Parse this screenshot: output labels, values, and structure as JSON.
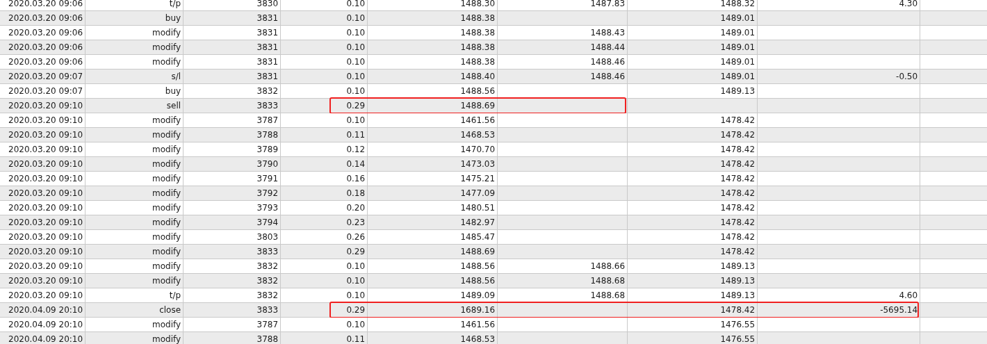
{
  "rows": [
    {
      "column_1": "2020.03.20 09:06",
      "column_2": "t/p",
      "column_3": "3830",
      "column_4": "0.10",
      "column_5": "1488.30",
      "column_6": "1487.83",
      "column_7": "1488.32",
      "column_8": "4.30"
    },
    {
      "column_1": "2020.03.20 09:06",
      "column_2": "buy",
      "column_3": "3831",
      "column_4": "0.10",
      "column_5": "1488.38",
      "column_7": "1489.01"
    },
    {
      "column_1": "2020.03.20 09:06",
      "column_2": "modify",
      "column_3": "3831",
      "column_4": "0.10",
      "column_5": "1488.38",
      "column_6": "1488.43",
      "column_7": "1489.01"
    },
    {
      "column_1": "2020.03.20 09:06",
      "column_2": "modify",
      "column_3": "3831",
      "column_4": "0.10",
      "column_5": "1488.38",
      "column_6": "1488.44",
      "column_7": "1489.01"
    },
    {
      "column_1": "2020.03.20 09:06",
      "column_2": "modify",
      "column_3": "3831",
      "column_4": "0.10",
      "column_5": "1488.38",
      "column_6": "1488.46",
      "column_7": "1489.01"
    },
    {
      "column_1": "2020.03.20 09:07",
      "column_2": "s/l",
      "column_3": "3831",
      "column_4": "0.10",
      "column_5": "1488.40",
      "column_6": "1488.46",
      "column_7": "1489.01",
      "column_8": "-0.50"
    },
    {
      "column_1": "2020.03.20 09:07",
      "column_2": "buy",
      "column_3": "3832",
      "column_4": "0.10",
      "column_5": "1488.56",
      "column_7": "1489.13"
    },
    {
      "column_1": "2020.03.20 09:10",
      "column_2": "sell",
      "column_3": "3833",
      "column_4": "0.29",
      "column_5": "1488.69",
      "boxed": true,
      "box_wide": false
    },
    {
      "column_1": "2020.03.20 09:10",
      "column_2": "modify",
      "column_3": "3787",
      "column_4": "0.10",
      "column_5": "1461.56",
      "column_7": "1478.42"
    },
    {
      "column_1": "2020.03.20 09:10",
      "column_2": "modify",
      "column_3": "3788",
      "column_4": "0.11",
      "column_5": "1468.53",
      "column_7": "1478.42"
    },
    {
      "column_1": "2020.03.20 09:10",
      "column_2": "modify",
      "column_3": "3789",
      "column_4": "0.12",
      "column_5": "1470.70",
      "column_7": "1478.42"
    },
    {
      "column_1": "2020.03.20 09:10",
      "column_2": "modify",
      "column_3": "3790",
      "column_4": "0.14",
      "column_5": "1473.03",
      "column_7": "1478.42"
    },
    {
      "column_1": "2020.03.20 09:10",
      "column_2": "modify",
      "column_3": "3791",
      "column_4": "0.16",
      "column_5": "1475.21",
      "column_7": "1478.42"
    },
    {
      "column_1": "2020.03.20 09:10",
      "column_2": "modify",
      "column_3": "3792",
      "column_4": "0.18",
      "column_5": "1477.09",
      "column_7": "1478.42"
    },
    {
      "column_1": "2020.03.20 09:10",
      "column_2": "modify",
      "column_3": "3793",
      "column_4": "0.20",
      "column_5": "1480.51",
      "column_7": "1478.42"
    },
    {
      "column_1": "2020.03.20 09:10",
      "column_2": "modify",
      "column_3": "3794",
      "column_4": "0.23",
      "column_5": "1482.97",
      "column_7": "1478.42"
    },
    {
      "column_1": "2020.03.20 09:10",
      "column_2": "modify",
      "column_3": "3803",
      "column_4": "0.26",
      "column_5": "1485.47",
      "column_7": "1478.42"
    },
    {
      "column_1": "2020.03.20 09:10",
      "column_2": "modify",
      "column_3": "3833",
      "column_4": "0.29",
      "column_5": "1488.69",
      "column_7": "1478.42"
    },
    {
      "column_1": "2020.03.20 09:10",
      "column_2": "modify",
      "column_3": "3832",
      "column_4": "0.10",
      "column_5": "1488.56",
      "column_6": "1488.66",
      "column_7": "1489.13"
    },
    {
      "column_1": "2020.03.20 09:10",
      "column_2": "modify",
      "column_3": "3832",
      "column_4": "0.10",
      "column_5": "1488.56",
      "column_6": "1488.68",
      "column_7": "1489.13"
    },
    {
      "column_1": "2020.03.20 09:10",
      "column_2": "t/p",
      "column_3": "3832",
      "column_4": "0.10",
      "column_5": "1489.09",
      "column_6": "1488.68",
      "column_7": "1489.13",
      "column_8": "4.60"
    },
    {
      "column_1": "2020.04.09 20:10",
      "column_2": "close",
      "column_3": "3833",
      "column_4": "0.29",
      "column_5": "1689.16",
      "column_7": "1478.42",
      "column_8": "-5695.14",
      "boxed": true,
      "box_wide": true
    },
    {
      "column_1": "2020.04.09 20:10",
      "column_2": "modify",
      "column_3": "3787",
      "column_4": "0.10",
      "column_5": "1461.56",
      "column_7": "1476.55"
    },
    {
      "column_1": "2020.04.09 20:10",
      "column_2": "modify",
      "column_3": "3788",
      "column_4": "0.11",
      "column_5": "1468.53",
      "column_7": "1476.55"
    }
  ]
}
